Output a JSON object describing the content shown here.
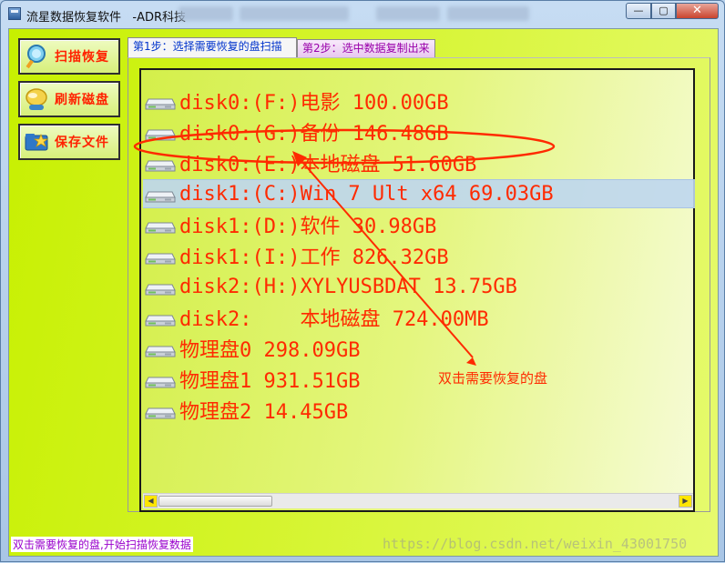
{
  "window": {
    "title": "流星数据恢复软件   -ADR科技",
    "controls": {
      "minimize": "—",
      "maximize": "▢",
      "close": "✕"
    }
  },
  "sidebar": {
    "buttons": [
      {
        "label": "扫描恢复",
        "icon": "magnifier-icon"
      },
      {
        "label": "刷新磁盘",
        "icon": "globe-icon"
      },
      {
        "label": "保存文件",
        "icon": "folder-star-icon"
      }
    ]
  },
  "tabs": [
    {
      "label": "第1步：选择需要恢复的盘扫描",
      "active": true
    },
    {
      "label": "第2步：选中数据复制出来",
      "active": false
    }
  ],
  "disk_list": {
    "selected_index": 3,
    "items": [
      {
        "text": "disk0:(F:)电影 100.00GB"
      },
      {
        "text": "disk0:(G:)备份 146.48GB"
      },
      {
        "text": "disk0:(E:)本地磁盘 51.60GB"
      },
      {
        "text": "disk1:(C:)Win 7 Ult x64 69.03GB"
      },
      {
        "text": "disk1:(D:)软件 30.98GB"
      },
      {
        "text": "disk1:(I:)工作 826.32GB"
      },
      {
        "text": "disk2:(H:)XYLYUSBDAT 13.75GB"
      },
      {
        "text": "disk2:    本地磁盘 724.00MB"
      },
      {
        "text": "物理盘0 298.09GB"
      },
      {
        "text": "物理盘1 931.51GB"
      },
      {
        "text": "物理盘2 14.45GB"
      }
    ]
  },
  "scrollbar": {
    "left_arrow": "◀",
    "right_arrow": "▶"
  },
  "status_bar": {
    "text": "双击需要恢复的盘,开始扫描恢复数据"
  },
  "annotation": {
    "text": "双击需要恢复的盘",
    "color": "#ff2a00"
  },
  "watermark": {
    "text": "https://blog.csdn.net/weixin_43001750"
  },
  "colors": {
    "accent_text": "#ff2a00",
    "panel_bg": "#c7f000",
    "selection": "#bed6f0"
  }
}
